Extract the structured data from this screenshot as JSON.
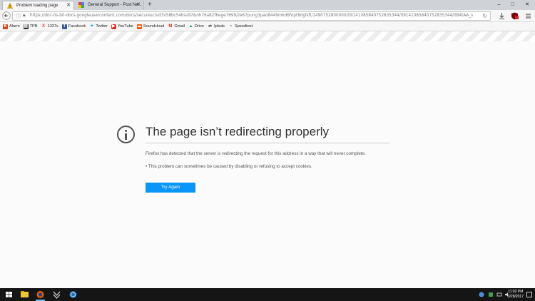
{
  "tabs": [
    {
      "label": "Problem loading page",
      "icon": "warning-icon",
      "active": true
    },
    {
      "label": "General Support - Post Ne...",
      "icon": "google-icon",
      "active": false
    }
  ],
  "window_controls": {
    "minimize": "–",
    "maximize": "□",
    "close": "✕"
  },
  "navbar": {
    "url": "https://doc-0s-b0-docs.googleusercontent.com/docs/securesc/vd3v58bc54ksv97&nh76a82f6ege7699/ze67pung3pao8449mkd6fopt8dglkfi/1490752800000/09141085840752835344/09141085840752835344/0B4tAA_s"
  },
  "bookmarks": [
    {
      "label": "Alarm",
      "icon": "alarm-icon",
      "color": "#d24726"
    },
    {
      "label": "TPB",
      "icon": "printer-icon",
      "color": "#333333"
    },
    {
      "label": "1337x",
      "icon": "1337x-icon",
      "color": "#e53935"
    },
    {
      "label": "Facebook",
      "icon": "facebook-icon",
      "color": "#3b5998"
    },
    {
      "label": "Twitter",
      "icon": "twitter-icon",
      "color": "#1da1f2"
    },
    {
      "label": "YouTube",
      "icon": "youtube-icon",
      "color": "#e62117"
    },
    {
      "label": "Soundcloud",
      "icon": "soundcloud-icon",
      "color": "#ff5500"
    },
    {
      "label": "Gmail",
      "icon": "gmail-icon",
      "color": "#d93025"
    },
    {
      "label": "Drive",
      "icon": "drive-icon",
      "color": "#1fa463"
    },
    {
      "label": "Ipleak",
      "icon": "ipleak-icon",
      "color": "#444444"
    },
    {
      "label": "Speedtest",
      "icon": "speedtest-icon",
      "color": "#333333"
    }
  ],
  "error": {
    "title": "The page isn’t redirecting properly",
    "description": "Firefox has detected that the server is redirecting the request for this address in a way that will never complete.",
    "bullet": "• This problem can sometimes be caused by disabling or refusing to accept cookies.",
    "button": "Try Again"
  },
  "taskbar": {
    "time": "11:02 PM",
    "date": "3/28/2017"
  },
  "colors": {
    "accent": "#0996f8",
    "taskbar": "#151515"
  }
}
